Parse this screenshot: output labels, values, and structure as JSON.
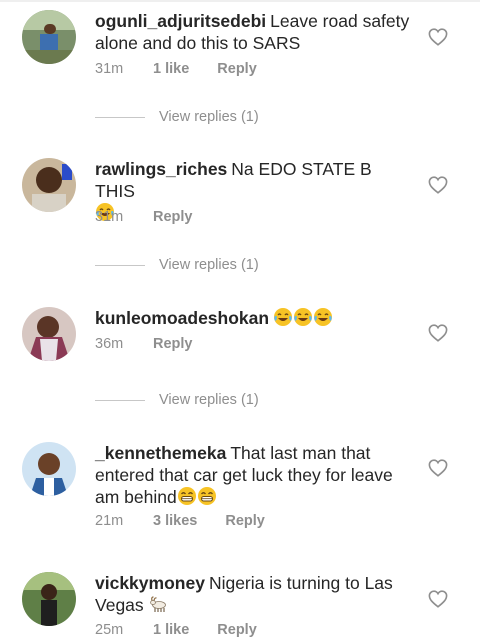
{
  "comments": [
    {
      "username": "ogunli_adjuritsedebi",
      "text": "Leave road safety alone and do this to SARS",
      "emojis": [],
      "time": "31m",
      "likes": "1 like",
      "reply": "Reply",
      "view_replies": "View replies (1)"
    },
    {
      "username": "rawlings_riches",
      "text": "Na EDO STATE B THIS",
      "emojis": [
        "face-with-tears-of-joy"
      ],
      "time": "31m",
      "likes": "",
      "reply": "Reply",
      "view_replies": "View replies (1)"
    },
    {
      "username": "kunleomoadeshokan",
      "text": "",
      "emojis": [
        "face-with-tears-of-joy",
        "face-with-tears-of-joy",
        "face-with-tears-of-joy"
      ],
      "time": "36m",
      "likes": "",
      "reply": "Reply",
      "view_replies": "View replies (1)"
    },
    {
      "username": "_kennethemeka",
      "text": "That last man that entered that car get luck they for leave am behind",
      "emojis": [
        "grinning-face-with-smiling-eyes",
        "grinning-face-with-smiling-eyes"
      ],
      "time": "21m",
      "likes": "3 likes",
      "reply": "Reply",
      "view_replies": ""
    },
    {
      "username": "vickkymoney",
      "text": "Nigeria is turning to Las Vegas",
      "emojis": [
        "goat"
      ],
      "time": "25m",
      "likes": "1 like",
      "reply": "Reply",
      "view_replies": ""
    }
  ],
  "icons": {
    "like": "heart-outline-icon"
  },
  "colors": {
    "text": "#262626",
    "secondary": "#8e8e8e",
    "divider": "#c7c7c7"
  }
}
